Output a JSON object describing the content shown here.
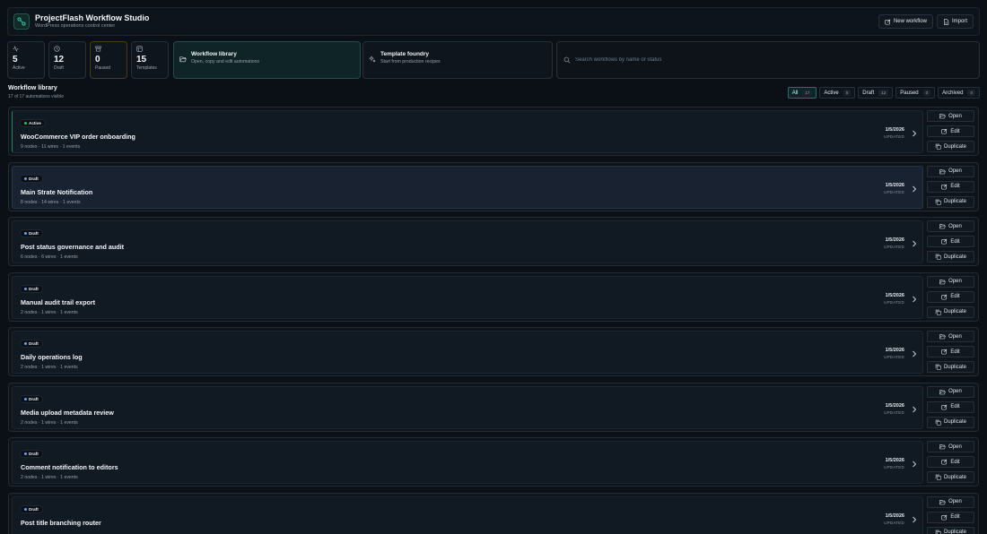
{
  "app": {
    "title": "ProjectFlash Workflow Studio",
    "subtitle": "WordPress operations control center"
  },
  "header_actions": {
    "new_workflow": "New workflow",
    "import": "Import"
  },
  "stats": [
    {
      "value": "5",
      "label": "Active",
      "icon": "activity-icon"
    },
    {
      "value": "12",
      "label": "Draft",
      "icon": "clock-icon"
    },
    {
      "value": "0",
      "label": "Paused",
      "icon": "archive-box-icon"
    },
    {
      "value": "15",
      "label": "Templates",
      "icon": "template-icon"
    }
  ],
  "nav": {
    "library": {
      "title": "Workflow library",
      "subtitle": "Open, copy and edit automations"
    },
    "foundry": {
      "title": "Template foundry",
      "subtitle": "Start from production recipes"
    }
  },
  "search": {
    "placeholder": "Search workflows by name or status"
  },
  "section": {
    "title": "Workflow library",
    "subtitle": "17 of 17 automations visible"
  },
  "filters": [
    {
      "label": "All",
      "count": "17"
    },
    {
      "label": "Active",
      "count": "5"
    },
    {
      "label": "Draft",
      "count": "12"
    },
    {
      "label": "Paused",
      "count": "0"
    },
    {
      "label": "Archived",
      "count": "0"
    }
  ],
  "row_actions": {
    "open": "Open",
    "edit": "Edit",
    "duplicate": "Duplicate",
    "updated": "UPDATED"
  },
  "colors": {
    "active_status": "#22c55e",
    "draft_status": "#60a5fa",
    "accent": "#2f6d69"
  },
  "workflows": [
    {
      "status": "Active",
      "name": "WooCommerce VIP order onboarding",
      "meta": "9 nodes · 11 wires · 1 events",
      "date": "1/5/2026"
    },
    {
      "status": "Draft",
      "name": "Main Strate Notification",
      "meta": "8 nodes · 14 wires · 1 events",
      "date": "1/5/2026"
    },
    {
      "status": "Draft",
      "name": "Post status governance and audit",
      "meta": "6 nodes · 6 wires · 1 events",
      "date": "1/5/2026"
    },
    {
      "status": "Draft",
      "name": "Manual audit trail export",
      "meta": "2 nodes · 1 wires · 1 events",
      "date": "1/5/2026"
    },
    {
      "status": "Draft",
      "name": "Daily operations log",
      "meta": "2 nodes · 1 wires · 1 events",
      "date": "1/5/2026"
    },
    {
      "status": "Draft",
      "name": "Media upload metadata review",
      "meta": "2 nodes · 1 wires · 1 events",
      "date": "1/5/2026"
    },
    {
      "status": "Draft",
      "name": "Comment notification to editors",
      "meta": "2 nodes · 1 wires · 1 events",
      "date": "1/5/2026"
    },
    {
      "status": "Draft",
      "name": "Post title branching router",
      "meta": "",
      "date": "1/5/2026"
    }
  ]
}
